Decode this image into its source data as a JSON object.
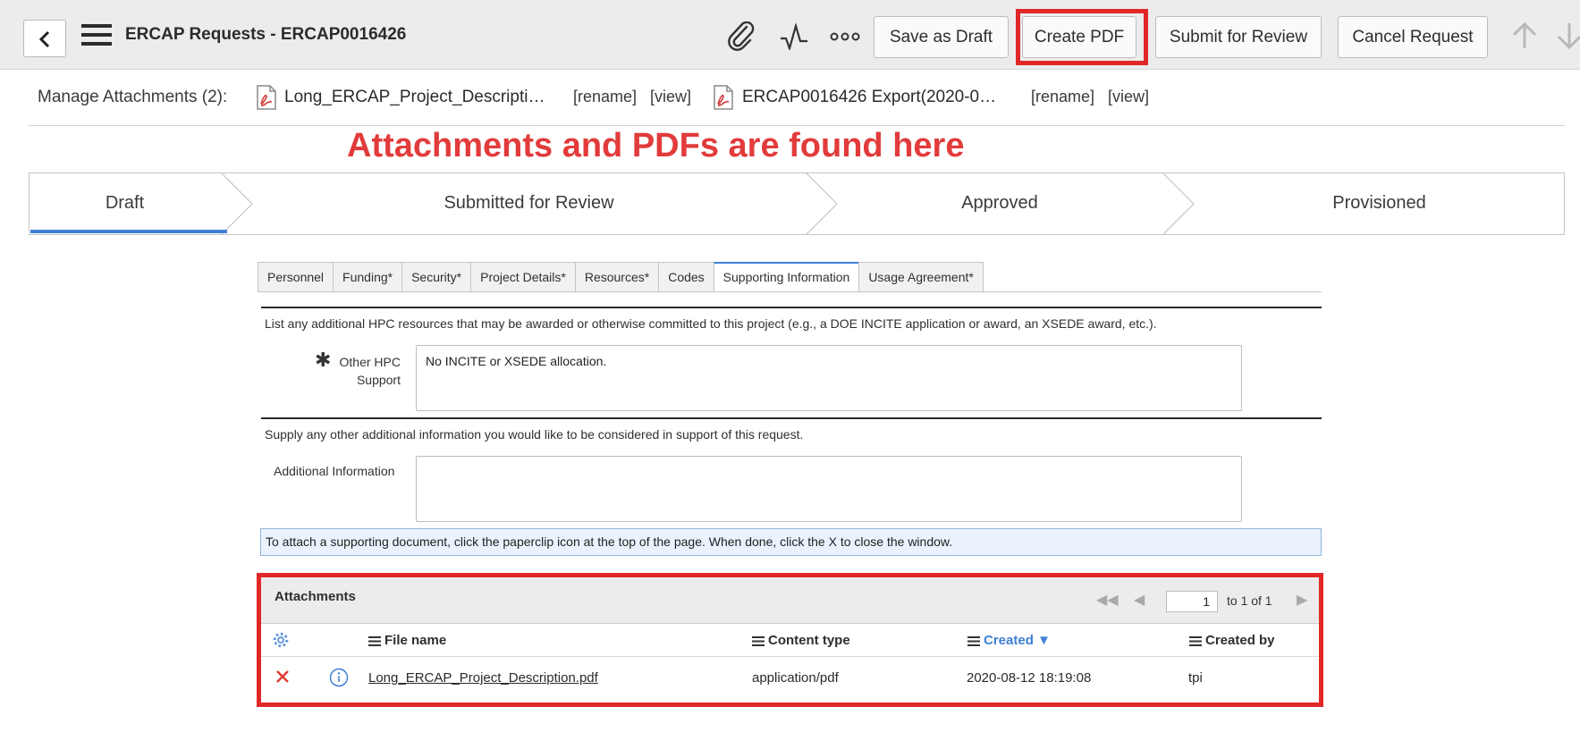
{
  "header": {
    "title": "ERCAP Requests - ERCAP0016426",
    "icons": [
      "back-chevron-icon",
      "hamburger-menu-icon",
      "paperclip-icon",
      "activity-icon",
      "more-options-icon",
      "arrow-up-icon",
      "arrow-down-icon"
    ],
    "buttons": {
      "save_draft": "Save as Draft",
      "create_pdf": "Create PDF",
      "submit_review": "Submit for Review",
      "cancel_request": "Cancel Request"
    },
    "highlight_color": "#e12727"
  },
  "attachments_bar": {
    "label": "Manage Attachments (2):",
    "items": [
      {
        "name": "Long_ERCAP_Project_Descripti…",
        "rename": "[rename]",
        "view": "[view]"
      },
      {
        "name": "ERCAP0016426 Export(2020-0…",
        "rename": "[rename]",
        "view": "[view]"
      }
    ]
  },
  "annotation": {
    "text": "Attachments and PDFs are found here",
    "color": "#e23b3b"
  },
  "stages": [
    {
      "label": "Draft",
      "active": true
    },
    {
      "label": "Submitted for Review",
      "active": false
    },
    {
      "label": "Approved",
      "active": false
    },
    {
      "label": "Provisioned",
      "active": false
    }
  ],
  "tabs": [
    {
      "label": "Personnel",
      "active": false
    },
    {
      "label": "Funding*",
      "active": false
    },
    {
      "label": "Security*",
      "active": false
    },
    {
      "label": "Project Details*",
      "active": false
    },
    {
      "label": "Resources*",
      "active": false
    },
    {
      "label": "Codes",
      "active": false
    },
    {
      "label": "Supporting Information",
      "active": true
    },
    {
      "label": "Usage Agreement*",
      "active": false
    }
  ],
  "form": {
    "section1_text": "List any additional HPC resources that may be awarded or otherwise committed to this project (e.g., a DOE INCITE application or award, an XSEDE award, etc.).",
    "other_hpc_label_1": "Other HPC",
    "other_hpc_label_2": "Support",
    "other_hpc_value": "No INCITE or XSEDE allocation.",
    "section2_text": "Supply any other additional information you would like to be considered in support of this request.",
    "additional_info_label": "Additional Information",
    "additional_info_value": "",
    "info_message": "To attach a supporting document, click the paperclip icon at the top of the page. When done, click the X to close the window."
  },
  "attachments_table": {
    "title": "Attachments",
    "page_value": "1",
    "page_of": "to 1 of 1",
    "columns": [
      "File name",
      "Content type",
      "Created ▼",
      "Created by"
    ],
    "rows": [
      {
        "file_name": "Long_ERCAP_Project_Description.pdf",
        "content_type": "application/pdf",
        "created": "2020-08-12 18:19:08",
        "created_by": "tpi"
      }
    ],
    "accent_color": "#3f7fd6"
  }
}
